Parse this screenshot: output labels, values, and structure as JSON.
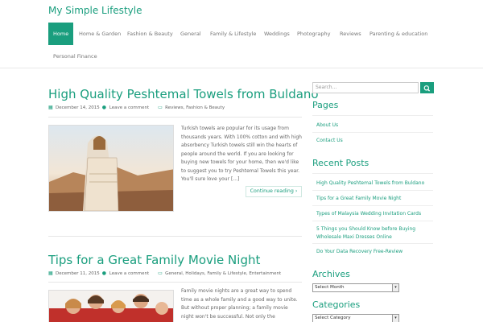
{
  "site": {
    "title": "My Simple Lifestyle"
  },
  "nav": {
    "items": [
      {
        "label": "Home",
        "active": true
      },
      {
        "label": "Home & Garden"
      },
      {
        "label": "Fashion & Beauty"
      },
      {
        "label": "General"
      },
      {
        "label": "Family & Lifestyle"
      },
      {
        "label": "Weddings"
      },
      {
        "label": "Photography"
      },
      {
        "label": "Reviews"
      },
      {
        "label": "Parenting & education"
      },
      {
        "label": "Personal Finance"
      }
    ]
  },
  "posts": [
    {
      "title": "High Quality Peshtemal Towels from Buldano",
      "date": "December 14, 2015",
      "comments": "Leave a comment",
      "categories": "Reviews, Fashion & Beauty",
      "excerpt": "Turkish towels are popular for its usage from thousands years. With 100% cotton and with high absorbency Turkish towels still win the hearts of people around the world. If you are looking for buying new towels for your home, then we'd like to suggest you to try Peshtemal Towels this year. You'll sure love your [...]",
      "continue": "Continue reading"
    },
    {
      "title": "Tips for a Great Family Movie Night",
      "date": "December 11, 2015",
      "comments": "Leave a comment",
      "categories": "General, Holidays, Family & Lifestyle, Entertainment",
      "excerpt": "Family movie nights are a great way to spend time as a whole family and a good way to unite. But without proper planning; a family movie night won't be successful. Not only the"
    }
  ],
  "sidebar": {
    "search_placeholder": "Search...",
    "pages_title": "Pages",
    "pages": [
      "About Us",
      "Contact Us"
    ],
    "recent_title": "Recent Posts",
    "recent": [
      "High Quality Peshtemal Towels from Buldano",
      "Tips for a Great Family Movie Night",
      "Types of Malaysia Wedding Invitation Cards",
      "5 Things you Should Know before Buying Wholesale Maxi Dresses Online",
      "Do Your Data Recovery Free-Review"
    ],
    "archives_title": "Archives",
    "archives_select": "Select Month",
    "categories_title": "Categories",
    "categories_select": "Select Category"
  },
  "colors": {
    "accent": "#1a9e7e"
  }
}
